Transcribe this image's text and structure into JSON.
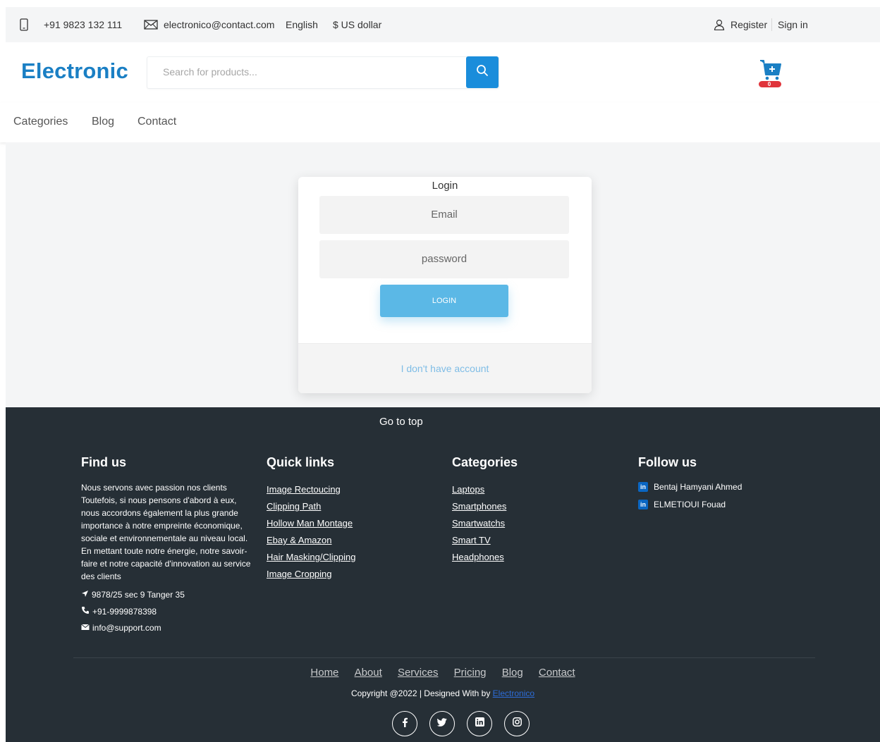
{
  "topbar": {
    "phone": "+91 9823 132 111",
    "email": "electronico@contact.com",
    "language": "English",
    "currency": "$ US dollar",
    "register": "Register",
    "signin": "Sign in"
  },
  "header": {
    "logo": "Electronic",
    "search_placeholder": "Search for products...",
    "cart_count": "0"
  },
  "nav": {
    "items": [
      "Categories",
      "Blog",
      "Contact"
    ]
  },
  "login": {
    "title": "Login",
    "email_placeholder": "Email",
    "password_placeholder": "password",
    "button": "LOGIN",
    "no_account": "I don't have account"
  },
  "footer": {
    "go_to_top": "Go to top",
    "find_us": {
      "heading": "Find us",
      "description": "Nous servons avec passion nos clients Toutefois, si nous pensons d'abord à eux, nous accordons également la plus grande importance à notre empreinte économique, sociale et environnementale au niveau local. En mettant toute notre énergie, notre savoir-faire et notre capacité d'innovation au service des clients",
      "address": "9878/25 sec 9 Tanger 35",
      "phone": "+91-9999878398",
      "email": "info@support.com"
    },
    "quick_links": {
      "heading": "Quick links",
      "items": [
        "Image Rectoucing",
        "Clipping Path",
        "Hollow Man Montage",
        "Ebay & Amazon",
        "Hair Masking/Clipping",
        "Image Cropping"
      ]
    },
    "categories": {
      "heading": "Categories",
      "items": [
        "Laptops",
        "Smartphones",
        "Smartwatchs",
        "Smart TV",
        "Headphones"
      ]
    },
    "follow_us": {
      "heading": "Follow us",
      "items": [
        "Bentaj Hamyani Ahmed",
        "ELMETIOUI Fouad"
      ]
    },
    "bottom_links": [
      "Home",
      "About",
      "Services",
      "Pricing",
      "Blog",
      "Contact"
    ],
    "copyright_prefix": "Copyright @2022 | Designed With by ",
    "copyright_brand": "Electronico"
  },
  "colors": {
    "brand_blue": "#1a7fc4",
    "search_button": "#1a8ddb",
    "login_button": "#5bb8e6",
    "footer_bg": "#262f36"
  }
}
